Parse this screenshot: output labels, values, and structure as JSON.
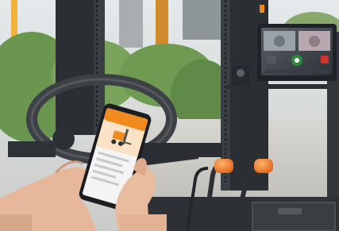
{
  "scene": {
    "description_tag": "forklift-cab-with-phone-and-camera-monitor",
    "colors": {
      "accent_orange": "#f08a1e",
      "mast_dark": "#2b2f33",
      "foliage": "#5f8a48",
      "floor": "#c9c7c2",
      "sky": "#dfe3e6"
    },
    "phone": {
      "app_header_color": "#f08a1e",
      "icon": "forklift-icon"
    },
    "monitor": {
      "icons": [
        "camera-view-left",
        "camera-view-right",
        "record-button",
        "stop-button"
      ]
    },
    "levers": {
      "count": 2,
      "knob_color": "#f07b24"
    }
  }
}
